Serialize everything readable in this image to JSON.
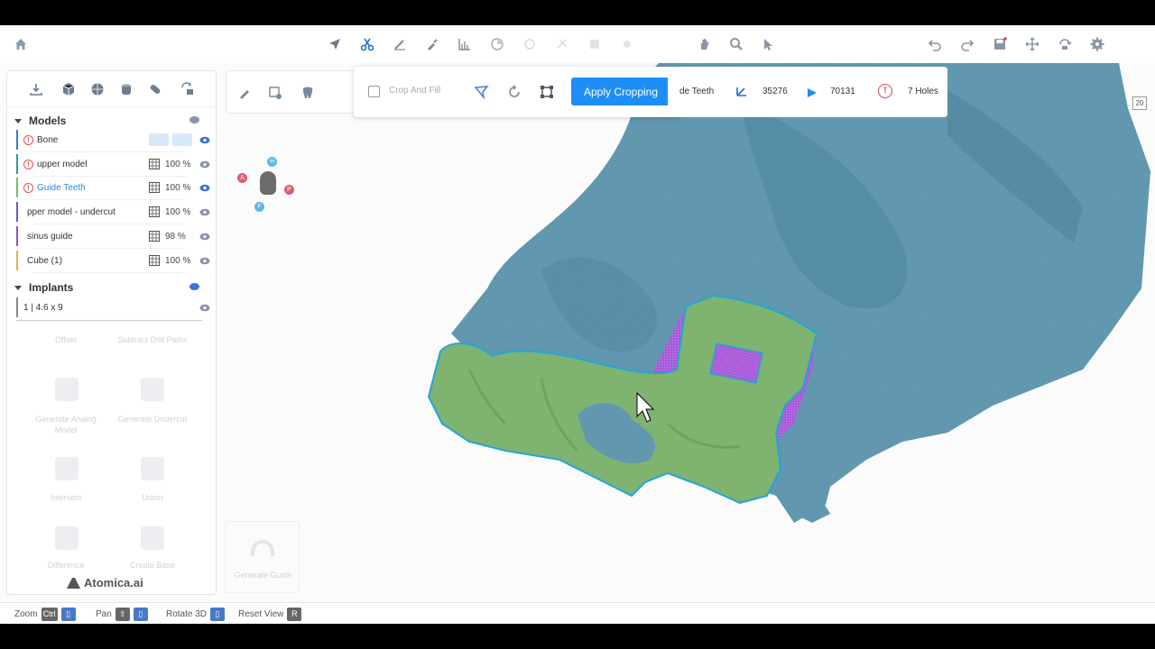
{
  "toolbar": {
    "icons": [
      "home-icon",
      "navigate-icon",
      "scissors-icon",
      "brush-icon",
      "paint-icon",
      "measure-icon",
      "sphere-icon",
      "redo-ghost-icon",
      "ghost-icon",
      "ghost-icon",
      "ghost-icon",
      "hand-icon",
      "zoom-icon",
      "pointer-icon",
      "undo-icon",
      "redo-icon",
      "save-icon",
      "move-icon",
      "rotate-icon",
      "settings-icon"
    ]
  },
  "left_panel": {
    "models_label": "Models",
    "models": [
      {
        "name": "Bone",
        "color": "#3a7bd5",
        "warn": true,
        "pct": ""
      },
      {
        "name": "upper model",
        "color": "#2aa08a",
        "warn": true,
        "pct": "100 %"
      },
      {
        "name": "Guide Teeth",
        "color": "#6cc070",
        "warn": true,
        "pct": "100 %"
      },
      {
        "name": "pper model  - undercut",
        "color": "#6a5acd",
        "warn": false,
        "pct": "100 %"
      },
      {
        "name": "sinus guide",
        "color": "#9b4dca",
        "warn": false,
        "pct": "98 %"
      },
      {
        "name": "Cube (1)",
        "color": "#e0b060",
        "warn": false,
        "pct": "100 %"
      }
    ],
    "implants_label": "Implants",
    "implants": [
      {
        "name": "1 | 4.6 x 9"
      }
    ],
    "actions": {
      "offset": "Offset",
      "subtract": "Subtract Drill Paths",
      "analog": "Generate Analog Model",
      "undercut": "Generate Undercut",
      "intersect": "Intersect",
      "union": "Union",
      "difference": "Difference",
      "base": "Create Base"
    },
    "brand": "Atomica.ai"
  },
  "crop": {
    "label": "Crop And Fill",
    "apply": "Apply Cropping"
  },
  "info": {
    "model": "de Teeth",
    "vertices": "35276",
    "faces": "70131",
    "holes": "7 Holes"
  },
  "orientation": {
    "a": "A",
    "p": "P",
    "h": "H",
    "f": "F"
  },
  "generate_guide": "Generate Guide",
  "corner_badge": "20",
  "bottom": {
    "zoom": "Zoom",
    "zoom_key": "Ctrl",
    "pan": "Pan",
    "rotate": "Rotate 3D",
    "reset": "Reset View",
    "reset_key": "R"
  },
  "colors": {
    "accent": "#1e8ef7",
    "bone": "#5f95ad",
    "guide": "#7fb370",
    "sinus": "#a85ad8"
  }
}
